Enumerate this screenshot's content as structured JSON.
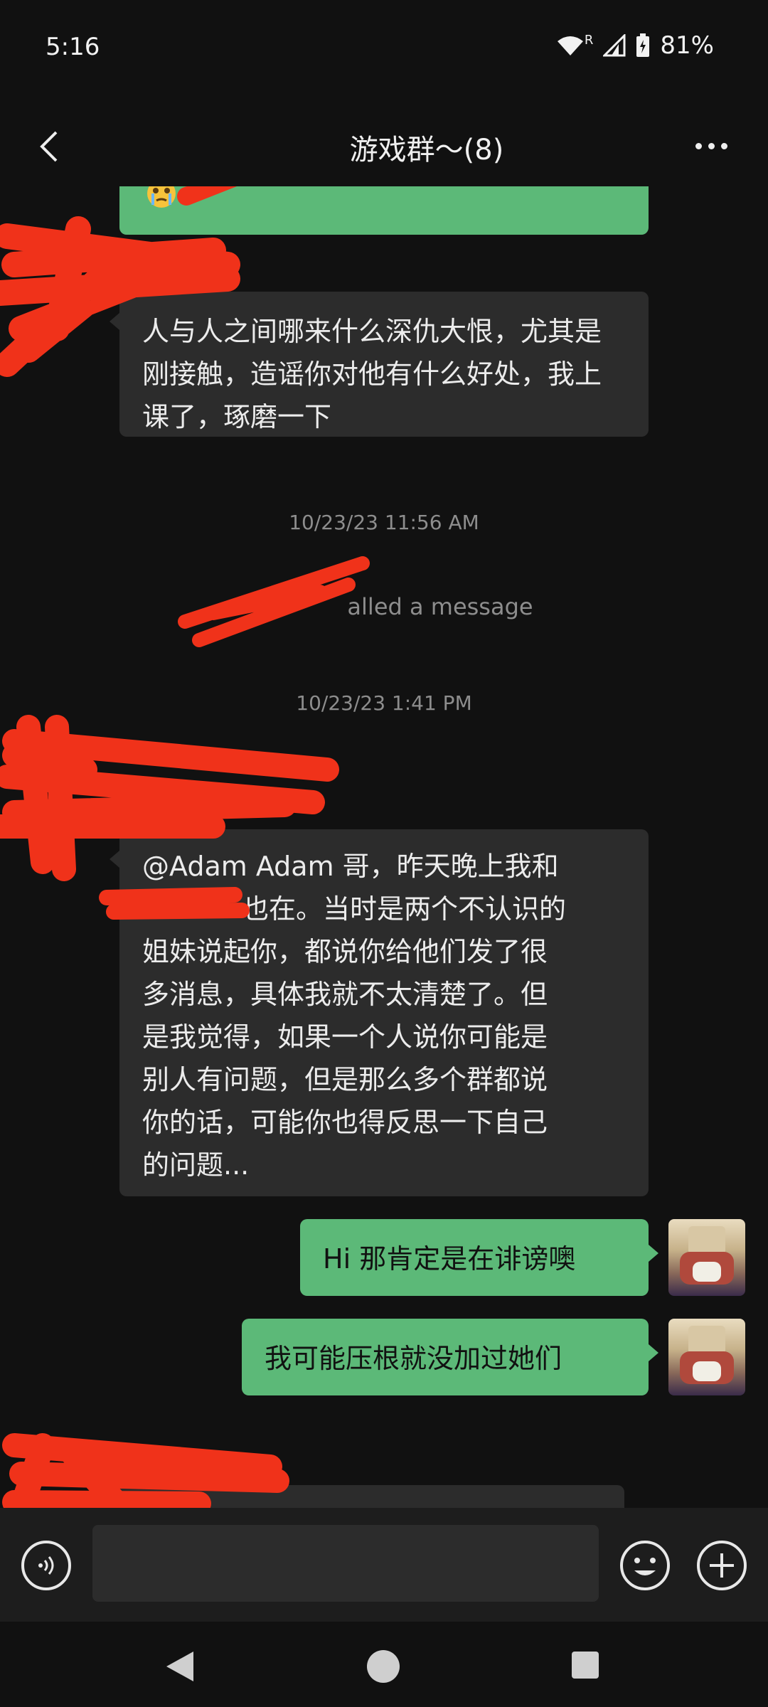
{
  "status_bar": {
    "time": "5:16",
    "battery_percent": "81%",
    "network_label": "R"
  },
  "header": {
    "title": "游戏群～(8)",
    "back_icon": "chevron-left-icon",
    "more_icon": "more-horizontal-icon"
  },
  "messages": [
    {
      "type": "incoming",
      "text": "人与人之间哪来什么深仇大恨，尤其是刚接触，造谣你对他有什么好处，我上课了，琢磨一下"
    },
    {
      "type": "timestamp",
      "text": "10/23/23 11:56 AM"
    },
    {
      "type": "system",
      "text": "alled a message"
    },
    {
      "type": "timestamp",
      "text": "10/23/23 1:41 PM"
    },
    {
      "type": "incoming",
      "lines": [
        "@Adam Adam 哥，昨天晚上我和",
        "也在。当时是两个不认识的",
        "姐妹说起你，都说你给他们发了很",
        "多消息，具体我就不太清楚了。但",
        "是我觉得，如果一个人说你可能是",
        "别人有问题，但是那么多个群都说",
        "你的话，可能你也得反思一下自己",
        "的问题..."
      ]
    },
    {
      "type": "outgoing",
      "text": "Hi 那肯定是在诽谤噢"
    },
    {
      "type": "outgoing",
      "text": "我可能压根就没加过她们"
    }
  ],
  "input_bar": {
    "placeholder": "",
    "voice_icon": "voice-icon",
    "emoji_icon": "emoji-icon",
    "plus_icon": "plus-icon"
  },
  "colors": {
    "background": "#111111",
    "incoming_bubble": "#2c2c2c",
    "outgoing_bubble": "#5cb978",
    "redaction": "#f0321a"
  }
}
